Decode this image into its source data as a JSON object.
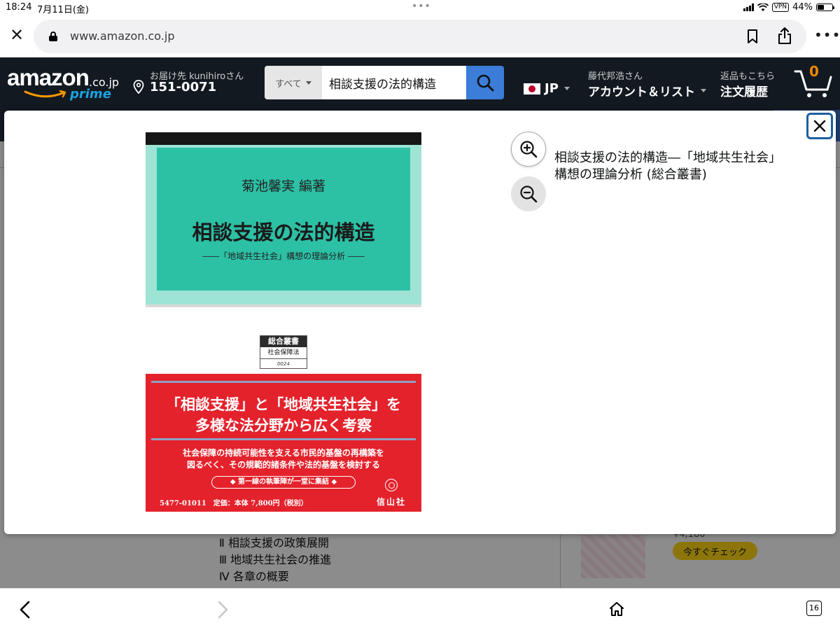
{
  "status_bar": {
    "time": "18:24",
    "date": "7月11日(金)",
    "vpn": "VPN",
    "battery": "44%"
  },
  "browser": {
    "url": "www.amazon.co.jp"
  },
  "header": {
    "logo": {
      "word": "amazon",
      "domain": ".co.jp",
      "prime": "prime"
    },
    "deliver_to": "お届け先 kunihiroさん",
    "postal_code": "151-0071",
    "search_category": "すべて",
    "search_query": "相談支援の法的構造",
    "language": "JP",
    "account_greeting": "藤代邦浩さん",
    "account_label": "アカウント＆リスト",
    "orders_line1": "返品もこちら",
    "orders_line2": "注文履歴",
    "cart_count": "0"
  },
  "modal": {
    "title": "相談支援の法的構造―「地域共生社会」構想の理論分析 (総合叢書)",
    "cover": {
      "author": "菊池馨実 編著",
      "title": "相談支援の法的構造",
      "subtitle": "――「地域共生社会」構想の理論分析 ――",
      "series_name": "総合叢書",
      "series_field": "社会保障法",
      "series_number": "0024",
      "headline1": "「相談支援」と「地域共生社会」を",
      "headline2": "多様な法分野から広く考察",
      "body1": "社会保障の持続可能性を支える市民的基盤の再構築を",
      "body2": "図るべく、その規範的諸条件や法的基盤を検討する",
      "pill": "◆ 第一線の執筆陣が一堂に集結 ◆",
      "price": "5477-01011　定価：本体 7,800円（税別）",
      "publisher": "信山社"
    }
  },
  "background": {
    "toc": [
      "Ⅱ 相談支援の政策展開",
      "Ⅲ 地域共生社会の推進",
      "Ⅳ 各章の概要"
    ],
    "price_partial": "¥4,180",
    "check_button": "今すぐチェック"
  },
  "bottom_bar": {
    "tabs_count": "16"
  },
  "colors": {
    "amazon_header": "#131921",
    "search_button": "#3b7dd8",
    "prime_blue": "#1aa3e0",
    "cart_orange": "#f08804",
    "cover_teal": "#2cc0a5",
    "cover_red": "#e4222c"
  }
}
